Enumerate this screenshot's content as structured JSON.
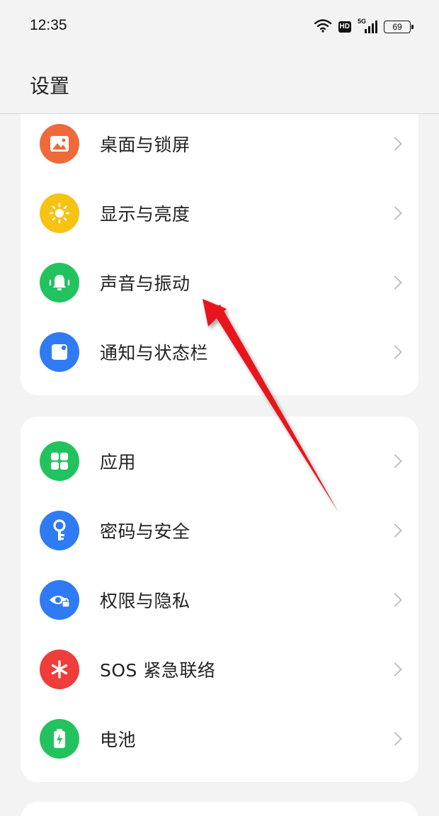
{
  "status_bar": {
    "time": "12:35",
    "hd_label": "HD",
    "network_label": "5G",
    "battery_level": "69"
  },
  "header": {
    "title": "设置"
  },
  "groups": [
    {
      "items": [
        {
          "label": "桌面与锁屏",
          "icon": "wallpaper-icon",
          "color": "#F0693A"
        },
        {
          "label": "显示与亮度",
          "icon": "brightness-icon",
          "color": "#F6C315"
        },
        {
          "label": "声音与振动",
          "icon": "bell-vibrate-icon",
          "color": "#22C35E"
        },
        {
          "label": "通知与状态栏",
          "icon": "notification-icon",
          "color": "#2F7BF5"
        }
      ]
    },
    {
      "items": [
        {
          "label": "应用",
          "icon": "apps-grid-icon",
          "color": "#22C35E"
        },
        {
          "label": "密码与安全",
          "icon": "key-icon",
          "color": "#2F7BF5"
        },
        {
          "label": "权限与隐私",
          "icon": "eye-lock-icon",
          "color": "#2F7BF5"
        },
        {
          "label": "SOS 紧急联络",
          "icon": "asterisk-icon",
          "color": "#EE3D3A"
        },
        {
          "label": "电池",
          "icon": "battery-icon",
          "color": "#22C35E"
        }
      ]
    }
  ],
  "annotation": {
    "arrow_color": "#E8131A"
  }
}
